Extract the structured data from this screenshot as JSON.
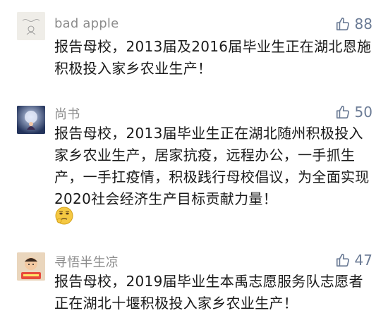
{
  "comments": [
    {
      "username": "bad apple",
      "likes": "88",
      "text": "报告母校，2013届及2016届毕业生正在湖北恩施积极投入家乡农业生产！",
      "avatar_icon": "sketch-avatar-icon"
    },
    {
      "username": "尚书",
      "likes": "50",
      "text": "报告母校，2013届毕业生正在湖北随州积极投入家乡农业生产，居家抗疫，远程办公，一手抓生产，一手扛疫情，积极践行母校倡议，为全面实现2020社会经济生产目标贡献力量！",
      "emoji": "thinking-face-emoji",
      "avatar_icon": "moon-avatar-icon"
    },
    {
      "username": "寻悟半生凉",
      "likes": "47",
      "text": "报告母校，2019届毕业生本禹志愿服务队志愿者正在湖北十堰积极投入家乡农业生产！",
      "avatar_icon": "cartoon-avatar-icon"
    }
  ],
  "colors": {
    "username": "#8c8c8c",
    "like": "#6b7b95",
    "text": "#1a1a1a"
  }
}
